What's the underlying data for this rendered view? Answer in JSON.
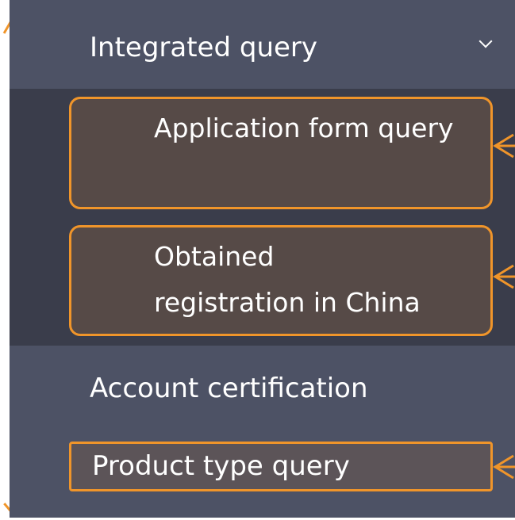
{
  "menu": {
    "group": {
      "label": "Integrated query",
      "expanded": true,
      "chevron_icon": "chevron-down-icon"
    },
    "sub_items": [
      {
        "label": "Application form query"
      },
      {
        "label_line1": "Obtained",
        "label_line2": "registration in China"
      }
    ],
    "items": [
      {
        "label": "Account certification"
      },
      {
        "label": "Product type query"
      }
    ]
  },
  "colors": {
    "menu_background": "#4d5265",
    "submenu_background": "#3a3d4b",
    "highlight_border": "#f0952a",
    "highlight_fill": "#564a47",
    "text": "#ffffff"
  }
}
